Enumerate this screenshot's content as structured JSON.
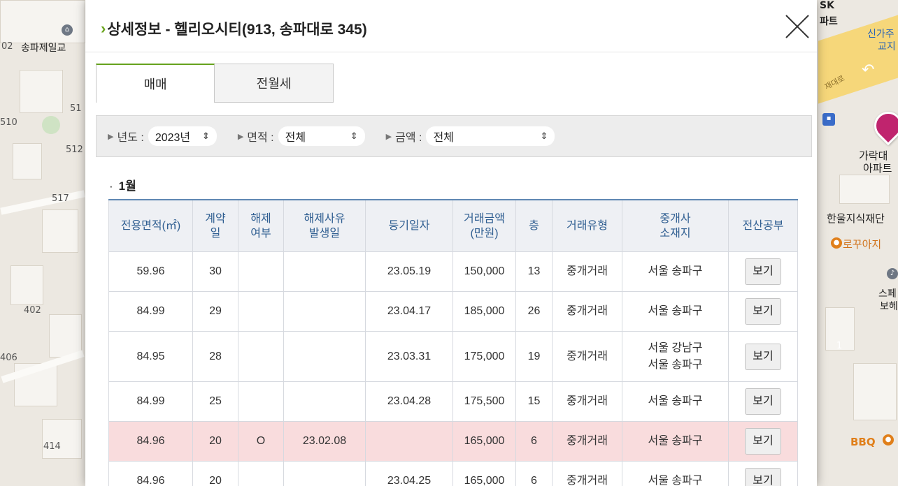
{
  "map": {
    "labels": [
      "송파제일교",
      "SK",
      "파트",
      "신가주",
      "교지",
      "재대로",
      "가락대",
      "아파트",
      "한울지식재단",
      "로꾸아지",
      "스페",
      "보헤",
      "BBQ"
    ],
    "numbers": [
      "02",
      "51",
      "510",
      "512",
      "517",
      "402",
      "406",
      "414",
      "1"
    ]
  },
  "modal": {
    "title": "상세정보 - 헬리오시티(913, 송파대로 345)",
    "tabs": [
      "매매",
      "전월세"
    ],
    "filters": [
      {
        "label": "년도 :",
        "value": "2023년"
      },
      {
        "label": "면적 :",
        "value": "전체"
      },
      {
        "label": "금액 :",
        "value": "전체"
      }
    ],
    "month": "1월",
    "table": {
      "headers": [
        "전용면적(㎡)",
        "계약\n일",
        "해제\n여부",
        "해제사유\n발생일",
        "등기일자",
        "거래금액\n(만원)",
        "층",
        "거래유형",
        "중개사\n소재지",
        "전산공부"
      ],
      "view_label": "보기",
      "rows": [
        {
          "area": "59.96",
          "day": "30",
          "cancel": "",
          "cancel_date": "",
          "reg_date": "23.05.19",
          "price": "150,000",
          "floor": "13",
          "type": "중개거래",
          "agent": "서울 송파구"
        },
        {
          "area": "84.99",
          "day": "29",
          "cancel": "",
          "cancel_date": "",
          "reg_date": "23.04.17",
          "price": "185,000",
          "floor": "26",
          "type": "중개거래",
          "agent": "서울 송파구"
        },
        {
          "area": "84.95",
          "day": "28",
          "cancel": "",
          "cancel_date": "",
          "reg_date": "23.03.31",
          "price": "175,000",
          "floor": "19",
          "type": "중개거래",
          "agent": "서울 강남구\n서울 송파구"
        },
        {
          "area": "84.99",
          "day": "25",
          "cancel": "",
          "cancel_date": "",
          "reg_date": "23.04.28",
          "price": "175,500",
          "floor": "15",
          "type": "중개거래",
          "agent": "서울 송파구"
        },
        {
          "area": "84.96",
          "day": "20",
          "cancel": "O",
          "cancel_date": "23.02.08",
          "reg_date": "",
          "price": "165,000",
          "floor": "6",
          "type": "중개거래",
          "agent": "서울 송파구"
        },
        {
          "area": "84.96",
          "day": "20",
          "cancel": "",
          "cancel_date": "",
          "reg_date": "23.04.25",
          "price": "165,000",
          "floor": "6",
          "type": "중개거래",
          "agent": "서울 송파구"
        }
      ]
    }
  },
  "colors": {
    "accent": "#66a21e",
    "header_text": "#2f5e91",
    "cancel_row": "#f9dcdd"
  }
}
